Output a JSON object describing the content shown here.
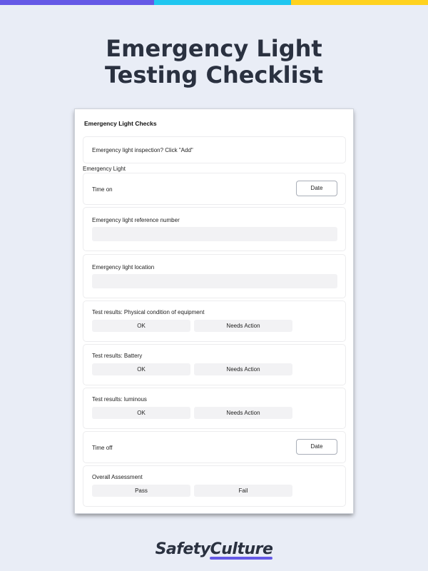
{
  "colors": {
    "bar_purple": "#6559e6",
    "bar_cyan": "#1fc6f0",
    "bar_yellow": "#ffd21f",
    "title": "#2a3140",
    "logo_underline": "#6559e6"
  },
  "page": {
    "title_line1": "Emergency Light",
    "title_line2": "Testing Checklist"
  },
  "form": {
    "header": "Emergency Light Checks",
    "inspection_prompt": "Emergency light inspection? Click \"Add\"",
    "section_label": "Emergency Light",
    "time_on": {
      "label": "Time on",
      "button": "Date"
    },
    "reference": {
      "label": "Emergency light reference number",
      "value": ""
    },
    "location": {
      "label": "Emergency light location",
      "value": ""
    },
    "physical": {
      "label": "Test results: Physical condition of equipment",
      "opt1": "OK",
      "opt2": "Needs Action"
    },
    "battery": {
      "label": "Test results: Battery",
      "opt1": "OK",
      "opt2": "Needs Action"
    },
    "luminous": {
      "label": "Test results: luminous",
      "opt1": "OK",
      "opt2": "Needs Action"
    },
    "time_off": {
      "label": "Time off",
      "button": "Date"
    },
    "overall": {
      "label": "Overall Assessment",
      "opt1": "Pass",
      "opt2": "Fail"
    }
  },
  "brand": {
    "logo_text": "SafetyCulture"
  }
}
